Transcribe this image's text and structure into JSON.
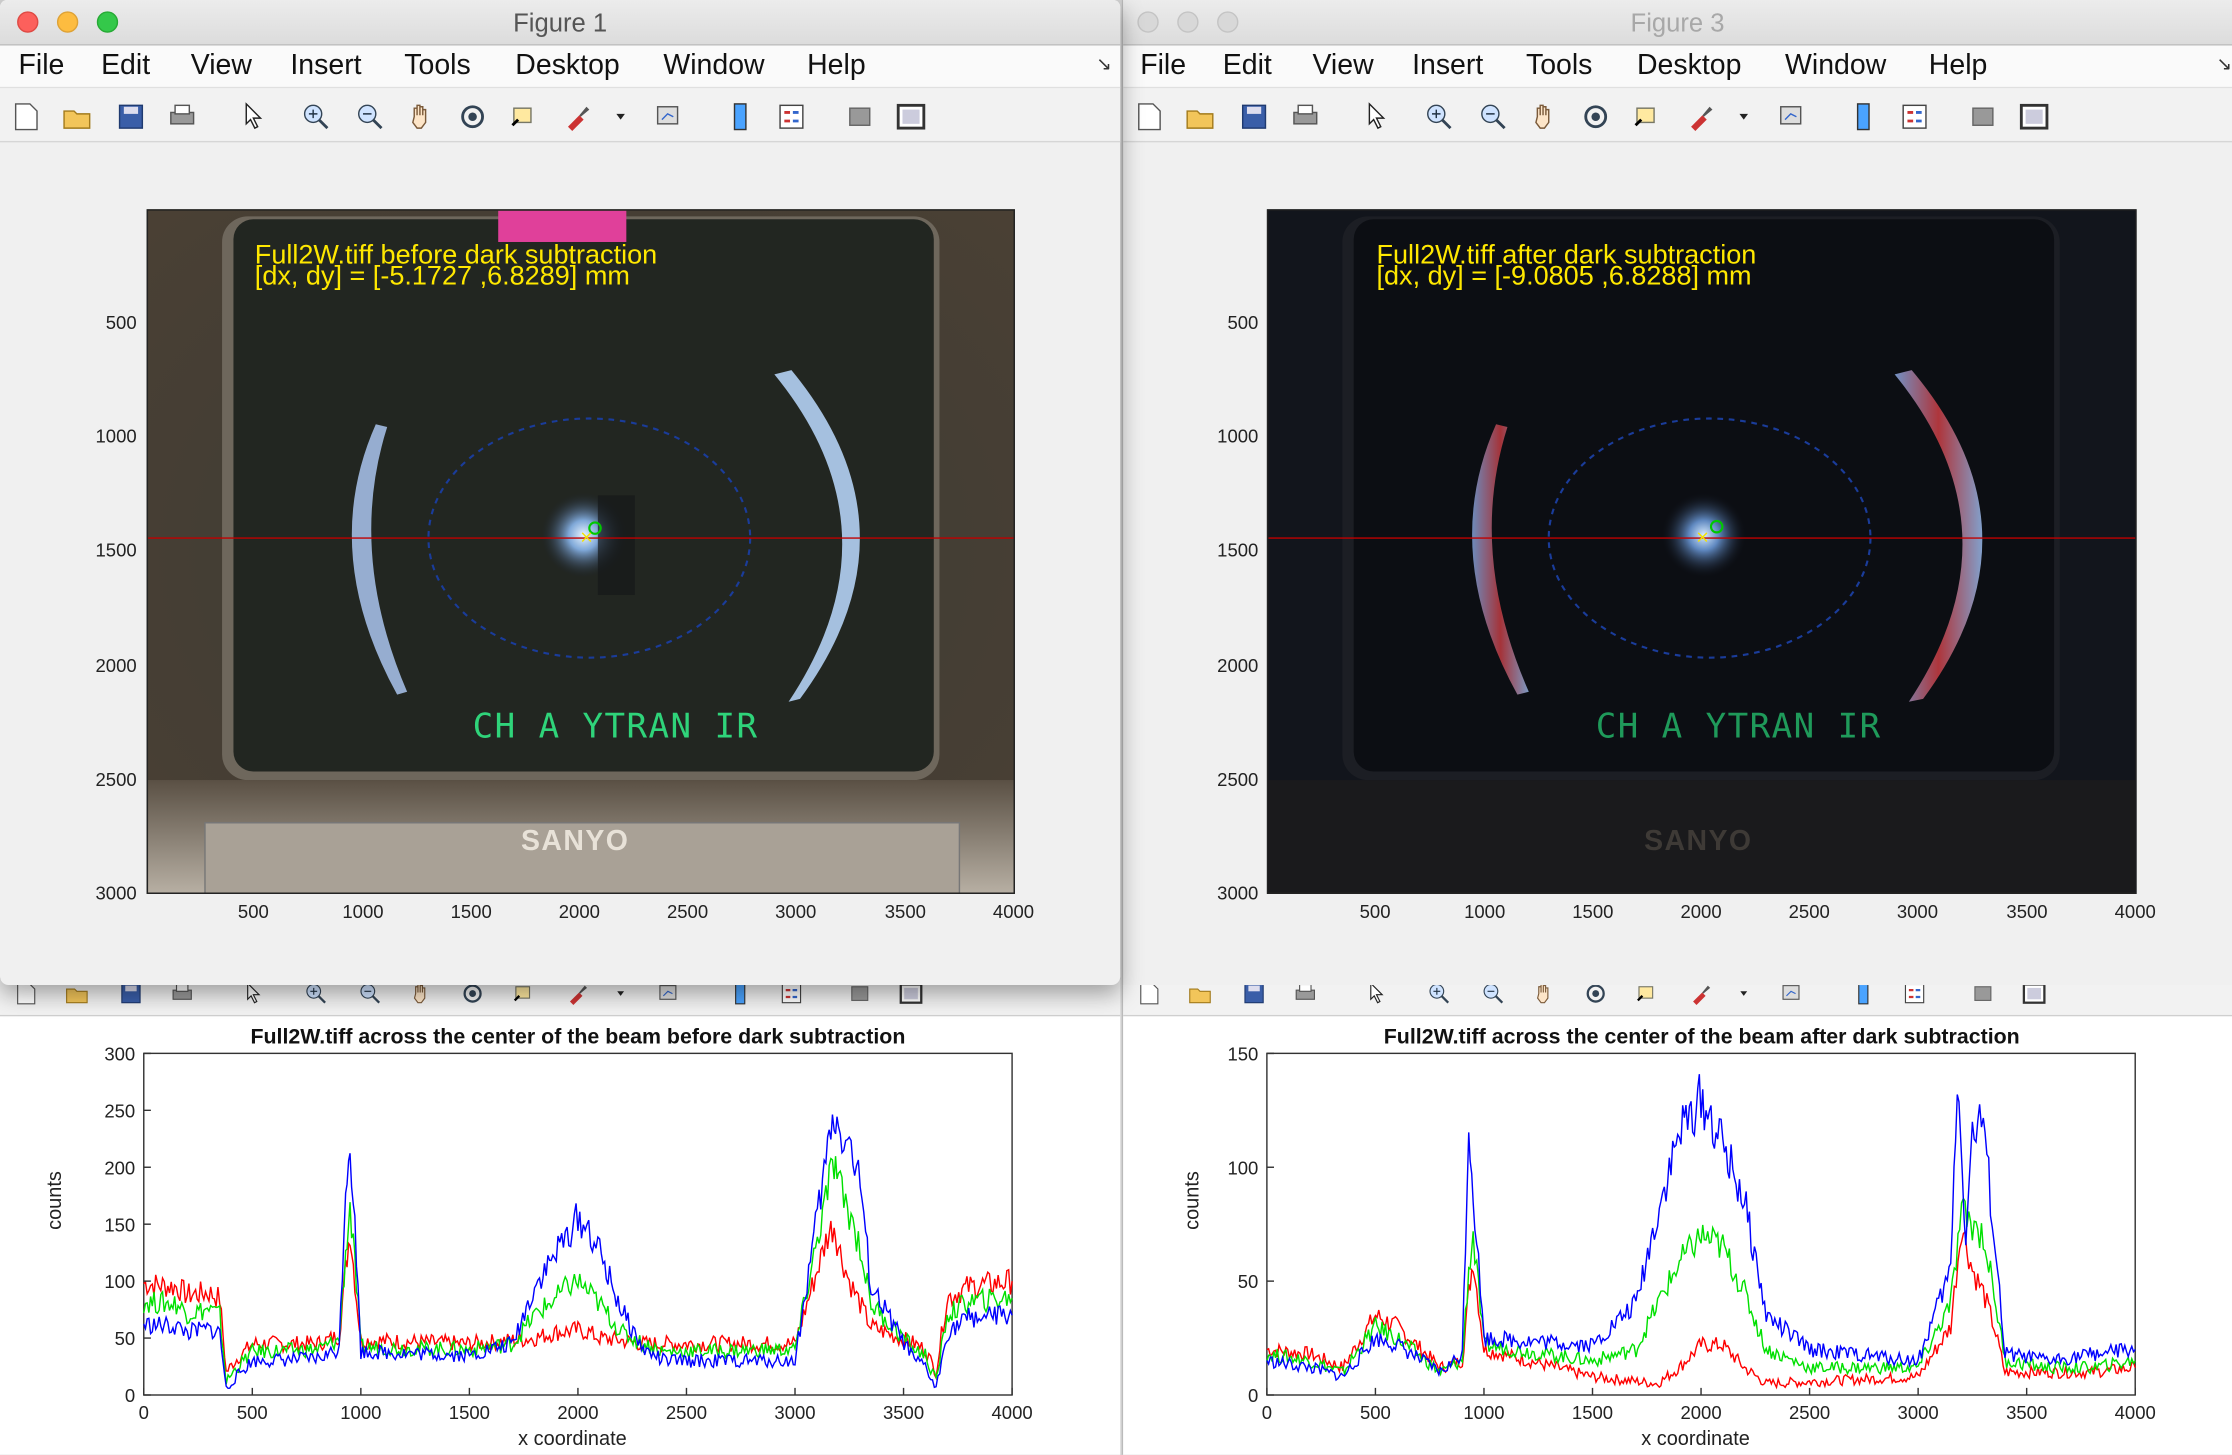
{
  "windows": [
    {
      "id": "fig1",
      "title": "Figure 1",
      "active": true,
      "menu": [
        "File",
        "Edit",
        "View",
        "Insert",
        "Tools",
        "Desktop",
        "Window",
        "Help"
      ],
      "overlay_line1": "Full2W.tiff before dark subtraction",
      "overlay_line2": "[dx, dy] = [-5.1727 ,6.8289] mm",
      "screen_text": "CH A YTRAN IR",
      "brand": "SANYO",
      "yticks": [
        "500",
        "1000",
        "1500",
        "2000",
        "2500",
        "3000"
      ],
      "xticks": [
        "500",
        "1000",
        "1500",
        "2000",
        "2500",
        "3000",
        "3500",
        "4000"
      ]
    },
    {
      "id": "fig3",
      "title": "Figure 3",
      "active": false,
      "menu": [
        "File",
        "Edit",
        "View",
        "Insert",
        "Tools",
        "Desktop",
        "Window",
        "Help"
      ],
      "overlay_line1": "Full2W.tiff after dark subtraction",
      "overlay_line2": "[dx, dy] = [-9.0805 ,6.8288] mm",
      "screen_text": "CH A YTRAN IR",
      "brand": "SANYO",
      "yticks": [
        "500",
        "1000",
        "1500",
        "2000",
        "2500",
        "3000"
      ],
      "xticks": [
        "500",
        "1000",
        "1500",
        "2000",
        "2500",
        "3000",
        "3500",
        "4000"
      ]
    }
  ],
  "toolbar_icons": [
    "new-file-icon",
    "open-folder-icon",
    "save-icon",
    "print-icon",
    "pointer-icon",
    "zoom-in-icon",
    "zoom-out-icon",
    "pan-hand-icon",
    "rotate-3d-icon",
    "data-cursor-icon",
    "brush-icon",
    "dropdown-arrow-icon",
    "link-plot-icon",
    "colorbar-icon",
    "legend-icon",
    "hide-plot-tools-icon",
    "show-plot-tools-icon"
  ],
  "colors": {
    "red": "#ff0000",
    "green": "#00e000",
    "blue": "#0000ff",
    "overlay_yellow": "#ffe800"
  },
  "chart_data": [
    {
      "type": "line",
      "title": "Full2W.tiff across the center of the beam before dark subtraction",
      "xlabel": "x coordinate",
      "ylabel": "counts",
      "xlim": [
        0,
        4000
      ],
      "ylim": [
        0,
        300
      ],
      "xticks": [
        0,
        500,
        1000,
        1500,
        2000,
        2500,
        3000,
        3500,
        4000
      ],
      "yticks": [
        0,
        50,
        100,
        150,
        200,
        250,
        300
      ],
      "grid": false,
      "series": [
        {
          "color": "#ff0000",
          "x": [
            0,
            150,
            200,
            300,
            350,
            380,
            420,
            500,
            800,
            900,
            930,
            950,
            980,
            1000,
            1500,
            1700,
            1800,
            1900,
            2000,
            2050,
            2100,
            2200,
            2300,
            2400,
            3000,
            3150,
            3180,
            3200,
            3250,
            3300,
            3350,
            3550,
            3600,
            3650,
            3700,
            3800,
            4000
          ],
          "y": [
            98,
            95,
            88,
            90,
            85,
            20,
            30,
            45,
            45,
            52,
            110,
            145,
            85,
            48,
            45,
            48,
            50,
            55,
            57,
            55,
            50,
            48,
            45,
            45,
            45,
            140,
            150,
            130,
            100,
            80,
            60,
            45,
            40,
            20,
            85,
            95,
            100
          ]
        },
        {
          "color": "#00e000",
          "x": [
            0,
            150,
            200,
            300,
            350,
            380,
            420,
            500,
            800,
            900,
            930,
            950,
            980,
            1000,
            1500,
            1700,
            1800,
            1900,
            1950,
            2000,
            2050,
            2100,
            2200,
            2300,
            2400,
            3000,
            3150,
            3180,
            3200,
            3250,
            3300,
            3350,
            3550,
            3600,
            3650,
            3700,
            3800,
            4000
          ],
          "y": [
            82,
            80,
            72,
            75,
            70,
            12,
            22,
            38,
            40,
            48,
            125,
            165,
            95,
            42,
            40,
            45,
            70,
            85,
            95,
            100,
            90,
            80,
            55,
            45,
            38,
            40,
            180,
            205,
            185,
            160,
            130,
            80,
            40,
            35,
            12,
            70,
            82,
            85
          ]
        },
        {
          "color": "#0000ff",
          "x": [
            0,
            150,
            200,
            300,
            350,
            380,
            420,
            500,
            800,
            900,
            930,
            950,
            980,
            1000,
            1500,
            1700,
            1800,
            1900,
            1950,
            2000,
            2050,
            2100,
            2200,
            2300,
            2400,
            3000,
            3150,
            3180,
            3200,
            3250,
            3300,
            3350,
            3550,
            3600,
            3650,
            3700,
            3800,
            4000
          ],
          "y": [
            62,
            60,
            55,
            58,
            55,
            5,
            15,
            30,
            32,
            40,
            185,
            225,
            120,
            38,
            35,
            45,
            95,
            125,
            140,
            155,
            145,
            125,
            75,
            40,
            30,
            30,
            215,
            248,
            235,
            220,
            185,
            95,
            30,
            25,
            5,
            55,
            68,
            70
          ]
        }
      ]
    },
    {
      "type": "line",
      "title": "Full2W.tiff across the center of the beam after dark subtraction",
      "xlabel": "x coordinate",
      "ylabel": "counts",
      "xlim": [
        0,
        4000
      ],
      "ylim": [
        0,
        150
      ],
      "xticks": [
        0,
        500,
        1000,
        1500,
        2000,
        2500,
        3000,
        3500,
        4000
      ],
      "yticks": [
        0,
        50,
        100,
        150
      ],
      "grid": false,
      "series": [
        {
          "color": "#ff0000",
          "x": [
            0,
            200,
            350,
            500,
            600,
            800,
            900,
            930,
            950,
            1000,
            1500,
            1800,
            1900,
            2000,
            2100,
            2200,
            2300,
            3000,
            3150,
            3200,
            3250,
            3300,
            3350,
            3400,
            3600,
            3800,
            4000
          ],
          "y": [
            20,
            18,
            12,
            35,
            30,
            12,
            15,
            45,
            60,
            20,
            8,
            5,
            12,
            22,
            22,
            12,
            5,
            8,
            30,
            75,
            55,
            45,
            30,
            10,
            10,
            10,
            12
          ]
        },
        {
          "color": "#00e000",
          "x": [
            0,
            200,
            350,
            500,
            600,
            800,
            900,
            930,
            950,
            1000,
            1500,
            1700,
            1800,
            1900,
            2000,
            2100,
            2200,
            2300,
            2500,
            3000,
            3150,
            3200,
            3250,
            3300,
            3350,
            3400,
            3600,
            3800,
            4000
          ],
          "y": [
            18,
            15,
            10,
            30,
            25,
            10,
            15,
            55,
            70,
            22,
            15,
            20,
            40,
            58,
            70,
            65,
            45,
            20,
            12,
            12,
            40,
            80,
            75,
            70,
            45,
            15,
            12,
            12,
            15
          ]
        },
        {
          "color": "#0000ff",
          "x": [
            0,
            200,
            350,
            500,
            600,
            800,
            900,
            930,
            950,
            1000,
            1500,
            1700,
            1800,
            1900,
            2000,
            2100,
            2200,
            2300,
            2500,
            3000,
            3150,
            3180,
            3220,
            3250,
            3300,
            3350,
            3400,
            3600,
            3800,
            4000
          ],
          "y": [
            15,
            12,
            8,
            25,
            22,
            10,
            18,
            120,
            90,
            25,
            22,
            40,
            80,
            115,
            130,
            110,
            85,
            35,
            20,
            15,
            55,
            140,
            70,
            115,
            120,
            70,
            18,
            15,
            18,
            20
          ]
        }
      ]
    }
  ]
}
